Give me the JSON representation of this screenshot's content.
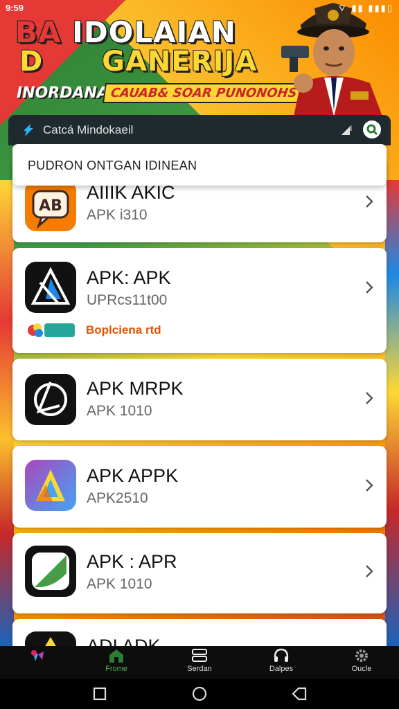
{
  "status_bar": {
    "time": "9:59",
    "icons": "⌔ ▮▮ ▮▮▮▯"
  },
  "banner": {
    "line1_first": "BA",
    "line1_rest": "IDOLAIAN",
    "line2": "D GANERIJA",
    "line3": "INORDANA",
    "line4": "CAUAB& SOAR PUNONOHS"
  },
  "app_bar": {
    "title": "Catcá Mindokaeil",
    "signal": "◢ᴵ",
    "search_icon": "search-icon"
  },
  "dropdown": {
    "text": "PUDRON ONTGAN IDINEAN"
  },
  "apps": [
    {
      "name": "AIIIK AKIC",
      "version": "APK i310",
      "icon": "ab-speech-icon"
    },
    {
      "name": "APK: APK",
      "version": "UPRcs11t00",
      "icon": "triangle-mark-icon",
      "extra_label": "Boplciena rtd"
    },
    {
      "name": "APK MRPK",
      "version": "APK 1010",
      "icon": "circle-arrow-icon"
    },
    {
      "name": "APK APPK",
      "version": "APK2510",
      "icon": "gradient-a-icon"
    },
    {
      "name": "APK : APR",
      "version": "APK 1010",
      "icon": "green-red-badge-icon"
    },
    {
      "name": "ADI ADK",
      "version": "",
      "icon": "yellow-triangle-icon"
    }
  ],
  "bottom_nav": [
    {
      "label": "",
      "icon": "puzzle-icon"
    },
    {
      "label": "Frome",
      "icon": "home-icon",
      "active": true
    },
    {
      "label": "Serdan",
      "icon": "server-icon"
    },
    {
      "label": "Dalpes",
      "icon": "headset-icon"
    },
    {
      "label": "Oucle",
      "icon": "gear-icon"
    }
  ],
  "system_nav": [
    "recents-button",
    "home-button",
    "back-button"
  ],
  "colors": {
    "accent_green": "#4caf50",
    "card_bg": "#ffffff",
    "app_bar_bg": "#1e2a2e"
  }
}
